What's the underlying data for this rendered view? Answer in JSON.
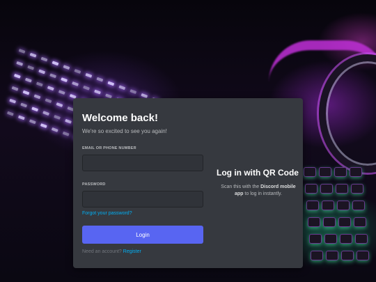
{
  "login": {
    "title": "Welcome back!",
    "subtitle": "We're so excited to see you again!",
    "email_label": "EMAIL OR PHONE NUMBER",
    "email_value": "",
    "password_label": "PASSWORD",
    "password_value": "",
    "forgot_link": "Forgot your password?",
    "login_button": "Login",
    "need_account": "Need an account?",
    "register_link": "Register"
  },
  "qr": {
    "title": "Log in with QR Code",
    "desc_prefix": "Scan this with the ",
    "desc_bold": "Discord mobile app",
    "desc_suffix": " to log in instantly."
  },
  "colors": {
    "modal_bg": "#36393f",
    "primary_button": "#5865f2",
    "link": "#00aff4"
  }
}
